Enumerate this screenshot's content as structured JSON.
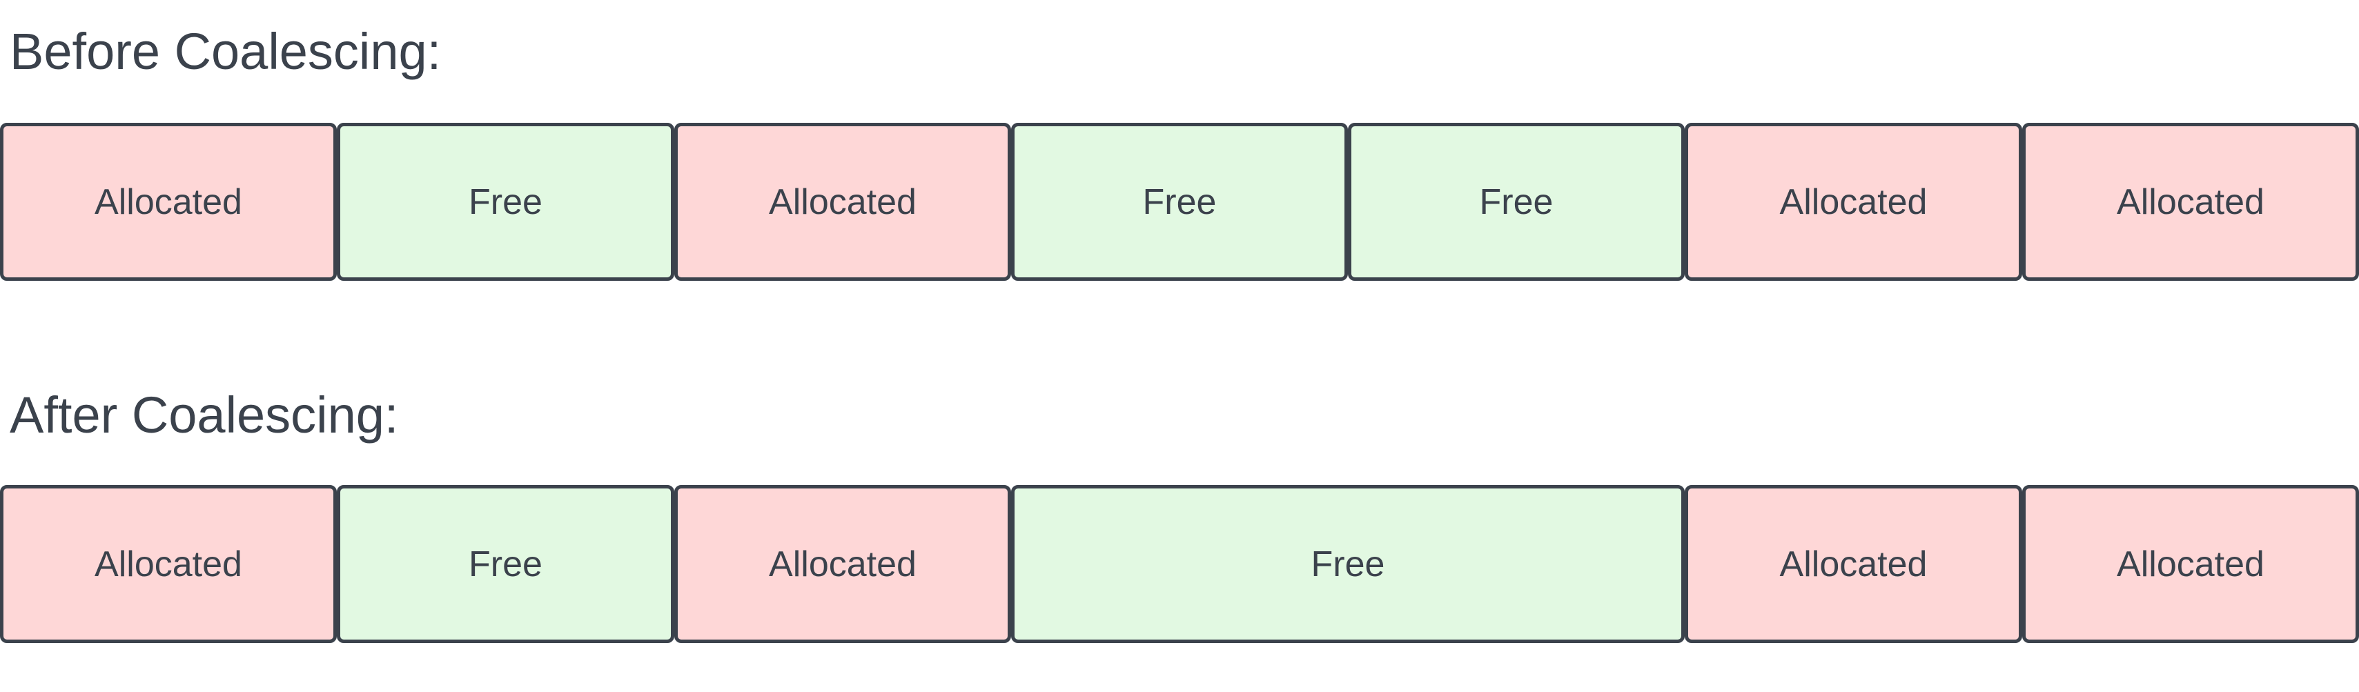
{
  "colors": {
    "allocated": "#fed7d7",
    "free": "#e2f9e2",
    "border": "#3b424c",
    "text": "#3b424c"
  },
  "before": {
    "heading": "Before Coalescing:",
    "blocks": [
      {
        "label": "Allocated",
        "state": "allocated",
        "units": 1
      },
      {
        "label": "Free",
        "state": "free",
        "units": 1
      },
      {
        "label": "Allocated",
        "state": "allocated",
        "units": 1
      },
      {
        "label": "Free",
        "state": "free",
        "units": 1
      },
      {
        "label": "Free",
        "state": "free",
        "units": 1
      },
      {
        "label": "Allocated",
        "state": "allocated",
        "units": 1
      },
      {
        "label": "Allocated",
        "state": "allocated",
        "units": 1
      }
    ]
  },
  "after": {
    "heading": "After Coalescing:",
    "blocks": [
      {
        "label": "Allocated",
        "state": "allocated",
        "units": 1
      },
      {
        "label": "Free",
        "state": "free",
        "units": 1
      },
      {
        "label": "Allocated",
        "state": "allocated",
        "units": 1
      },
      {
        "label": "Free",
        "state": "free",
        "units": 2
      },
      {
        "label": "Allocated",
        "state": "allocated",
        "units": 1
      },
      {
        "label": "Allocated",
        "state": "allocated",
        "units": 1
      }
    ]
  }
}
